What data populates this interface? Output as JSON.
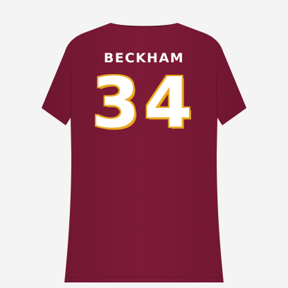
{
  "photo": {
    "subject": "t-shirt-back",
    "colors": {
      "background": "#f4f4f4",
      "shirt": "#7b1a35",
      "shirt_shadow": "#6a1530",
      "lettering": "#ffffff",
      "number_outline": "#e9a81f"
    }
  },
  "jersey": {
    "name": "BECKHAM",
    "number": "34"
  }
}
